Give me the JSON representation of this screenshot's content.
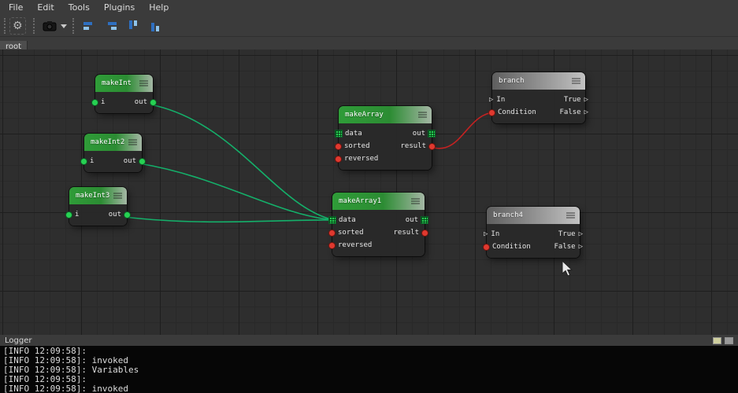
{
  "menu": {
    "items": [
      "File",
      "Edit",
      "Tools",
      "Plugins",
      "Help"
    ]
  },
  "toolbar": {
    "icons": [
      "drag-handle",
      "gear",
      "screenshot-camera",
      "dropdown-arrow",
      "align-bars-left",
      "align-bars-right",
      "align-bars-top",
      "align-bars-bottom"
    ],
    "gear_glyph": "⚙"
  },
  "tabs": {
    "active": "root"
  },
  "glyphs": {
    "exec_pin": "▷"
  },
  "colors": {
    "node_header_green": "#2f9c38",
    "node_header_gray": "#8f8f8f",
    "pin_green": "#27d153",
    "pin_red": "#e0392f",
    "wire_green": "#14b06a",
    "wire_red": "#c42222",
    "toolbar_icon_blue": "#2e6fc0",
    "toolbar_icon_lightblue": "#8fc3ea"
  },
  "nodes": [
    {
      "title": "makeInt",
      "inputs": [
        {
          "label": "i"
        }
      ],
      "outputs": [
        {
          "label": "out"
        }
      ]
    },
    {
      "title": "makeInt2",
      "inputs": [
        {
          "label": "i"
        }
      ],
      "outputs": [
        {
          "label": "out"
        }
      ]
    },
    {
      "title": "makeInt3",
      "inputs": [
        {
          "label": "i"
        }
      ],
      "outputs": [
        {
          "label": "out"
        }
      ]
    },
    {
      "title": "makeArray",
      "inputs": [
        {
          "label": "data"
        },
        {
          "label": "sorted"
        },
        {
          "label": "reversed"
        }
      ],
      "outputs": [
        {
          "label": "out"
        },
        {
          "label": "result"
        }
      ]
    },
    {
      "title": "makeArray1",
      "inputs": [
        {
          "label": "data"
        },
        {
          "label": "sorted"
        },
        {
          "label": "reversed"
        }
      ],
      "outputs": [
        {
          "label": "out"
        },
        {
          "label": "result"
        }
      ]
    },
    {
      "title": "branch",
      "inputs": [
        {
          "label": "In"
        },
        {
          "label": "Condition"
        }
      ],
      "outputs": [
        {
          "label": "True"
        },
        {
          "label": "False"
        }
      ]
    },
    {
      "title": "branch4",
      "inputs": [
        {
          "label": "In"
        },
        {
          "label": "Condition"
        }
      ],
      "outputs": [
        {
          "label": "True"
        },
        {
          "label": "False"
        }
      ]
    }
  ],
  "logger": {
    "title": "Logger",
    "lines": [
      "[INFO 12:09:58]:",
      "[INFO 12:09:58]: invoked",
      "[INFO 12:09:58]: Variables",
      "[INFO 12:09:58]:",
      "[INFO 12:09:58]: invoked"
    ]
  }
}
